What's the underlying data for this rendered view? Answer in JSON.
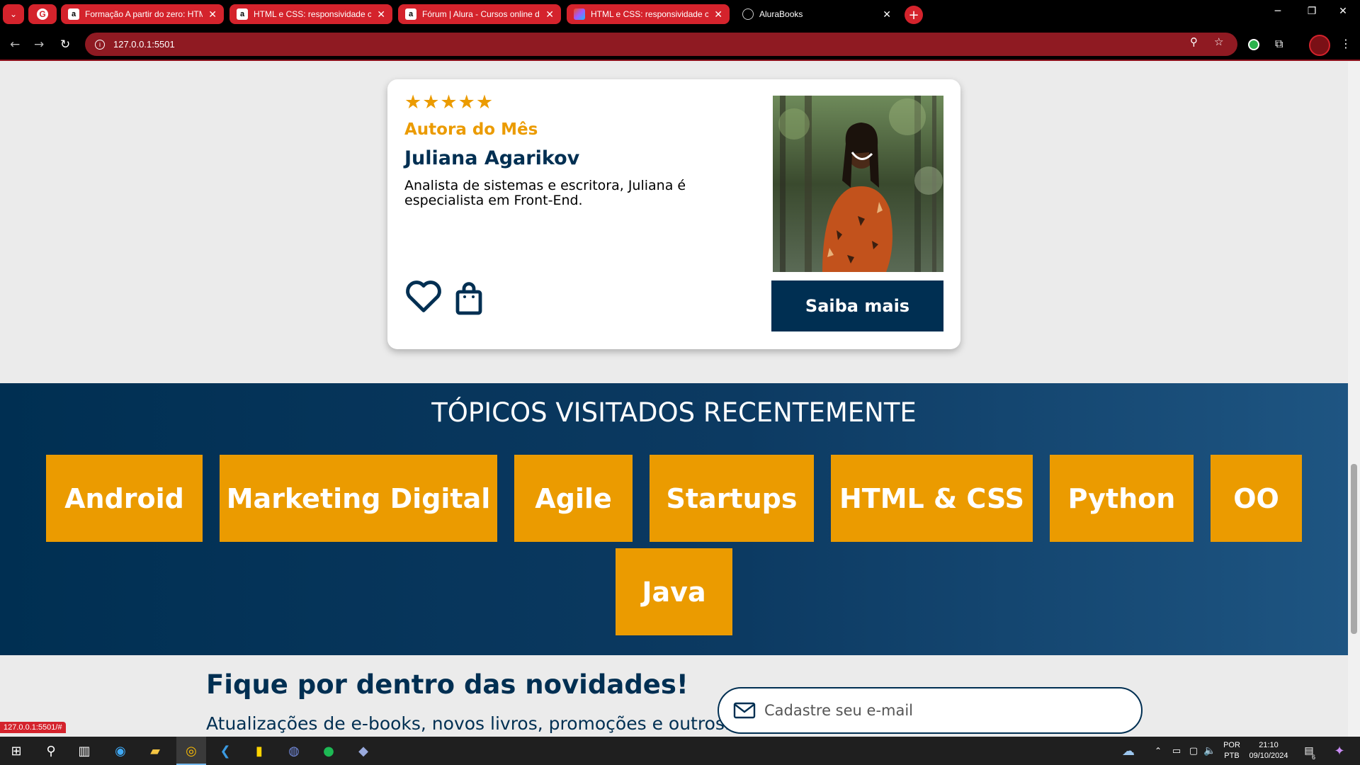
{
  "browser": {
    "tabs": [
      {
        "label": "Formação A partir do zero: HTM",
        "icon": "alura-icon"
      },
      {
        "label": "HTML e CSS: responsividade co",
        "icon": "alura-icon"
      },
      {
        "label": "Fórum | Alura - Cursos online d",
        "icon": "alura-icon"
      },
      {
        "label": "HTML e CSS: responsividade co",
        "icon": "figma-icon"
      },
      {
        "label": "AluraBooks",
        "icon": "globe-icon"
      }
    ],
    "url": "127.0.0.1:5501",
    "status_url": "127.0.0.1:5501/#",
    "accent_color": "#d4232c"
  },
  "author_card": {
    "stars": "★★★★★",
    "tag": "Autora do Mês",
    "name": "Juliana Agarikov",
    "description": "Analista de sistemas e escritora, Juliana é especialista em Front-End.",
    "button": "Saiba mais",
    "rating": 5
  },
  "topics": {
    "title": "TÓPICOS VISITADOS RECENTEMENTE",
    "items": [
      "Android",
      "Marketing Digital",
      "Agile",
      "Startups",
      "HTML & CSS",
      "Python",
      "OO",
      "Java"
    ]
  },
  "newsletter": {
    "title": "Fique por dentro das novidades!",
    "subtitle": "Atualizações de e-books, novos livros, promoções e outros.",
    "placeholder": "Cadastre seu e-mail"
  },
  "taskbar": {
    "lang1": "POR",
    "lang2": "PTB",
    "time": "21:10",
    "date": "09/10/2024",
    "notifications": "6"
  },
  "colors": {
    "primary": "#002f52",
    "accent": "#eb9b00"
  }
}
